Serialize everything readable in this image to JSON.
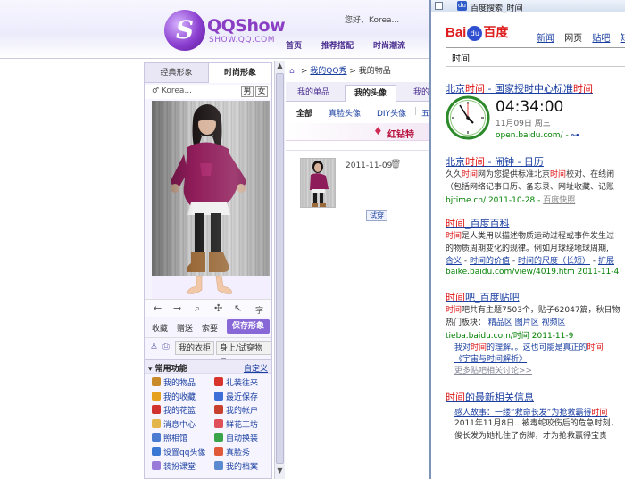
{
  "qqshow": {
    "logo_text": "QQShow",
    "logo_sub": "SHOW.QQ.COM",
    "greeting": "您好，",
    "user_short": "Korea...",
    "user_name": "Korea...",
    "nav": [
      "首页",
      "推荐搭配",
      "时尚潮流"
    ],
    "left_tabs": [
      "经典形象",
      "时尚形象"
    ],
    "gender_buttons": [
      "男",
      "女"
    ],
    "zoom_icon_label": "字",
    "actions": [
      "收藏",
      "赠送",
      "索要"
    ],
    "save_button": "保存形象",
    "wardrobe_buttons": [
      "我的衣柜",
      "身上/试穿物品"
    ],
    "functions_title": "常用功能",
    "customize": "自定义",
    "functions": [
      {
        "label": "我的物品",
        "color": "#c98a2a"
      },
      {
        "label": "礼装往来",
        "color": "#d9342b"
      },
      {
        "label": "我的收藏",
        "color": "#e5a020"
      },
      {
        "label": "最近保存",
        "color": "#3e6fd8"
      },
      {
        "label": "我的花篮",
        "color": "#d2322f"
      },
      {
        "label": "我的帐户",
        "color": "#c8402e"
      },
      {
        "label": "消息中心",
        "color": "#e4b54a"
      },
      {
        "label": "鲜花工坊",
        "color": "#e0505a"
      },
      {
        "label": "照相馆",
        "color": "#4a7bd0"
      },
      {
        "label": "自动换装",
        "color": "#3aa44a"
      },
      {
        "label": "设置qq头像",
        "color": "#3a78d4"
      },
      {
        "label": "真脸秀",
        "color": "#e05a3a"
      },
      {
        "label": "装扮课堂",
        "color": "#9a7ad8"
      },
      {
        "label": "我的档案",
        "color": "#5a8ad0"
      }
    ],
    "breadcrumb": [
      "我的QQ秀",
      "我的物品"
    ],
    "breadcrumb_sep": ">",
    "right_tabs": [
      "我的单品",
      "我的头像",
      "我的"
    ],
    "sub_tabs": [
      "全部",
      "真脸头像",
      "DIY头像",
      "五"
    ],
    "promo_text": "红钻特",
    "item_date": "2011-11-09",
    "try_button": "试穿"
  },
  "baidu": {
    "window_title": "百度搜索_时间",
    "logo_bai": "Bai",
    "logo_paw": "du",
    "logo_du": "百度",
    "nav": [
      "新闻",
      "网页",
      "贴吧",
      "知道"
    ],
    "query": "时间",
    "results": [
      {
        "title_a": "北京",
        "title_em": "时间",
        "title_b": " - 国家授时中心标准",
        "title_em2": "时间",
        "time": "04:34:00",
        "date": "11月09日  周三",
        "url": "open.baidu.com/ - ",
        "url_extra": "⊶"
      },
      {
        "title_a": "北京",
        "title_em": "时间",
        "title_b": " - 闹钟 - 日历",
        "body1_a": "久久",
        "body1_em": "时间",
        "body1_b": "网为您提供标准北京",
        "body1_em2": "时间",
        "body1_c": "校对、在线闹",
        "body2": "（包括网络记事日历、备忘录、网址收藏、记账",
        "url": "bjtime.cn/ 2011-10-28 - ",
        "snapshot": "百度快照"
      },
      {
        "title_em": "时间",
        "title_b": "_百度百科",
        "body1_em": "时间",
        "body1_b": "是人类用以描述物质运动过程或事件发生过",
        "body2": "的物质周期变化的规律。例如月球绕地球周期,",
        "links": [
          "含义",
          "时间的价值",
          "时间的尺度（长短）",
          "扩展"
        ],
        "url": "baike.baidu.com/view/4019.htm 2011-11-4"
      },
      {
        "title_em": "时间",
        "title_b": "吧_百度贴吧",
        "body1_em": "时间",
        "body1_b": "吧共有主题7503个，贴子62047篇，秋日物",
        "body2_a": "热门板块：",
        "body2_links": [
          "精品区",
          "图片区",
          "视频区"
        ],
        "url": "tieba.baidu.com/时间 2011-11-9",
        "sub1_a": "我对",
        "sub1_em": "时间",
        "sub1_b": "的理解。。这也可能是真正的",
        "sub1_em2": "时间",
        "sub2": "《宇宙与时间解析》",
        "sub3": "更多贴吧相关讨论>>"
      },
      {
        "title_em": "时间",
        "title_b": "的最新相关信息",
        "sub1": "感人故事：一缕“救命长发”为抢救霸得",
        "sub1_em": "时间",
        "body1": "2011年11月8日...被毒蛇咬伤后的危急时刻，",
        "body2": "俊长发为她扎住了伤脚，才为抢救赢得宝贵"
      }
    ]
  }
}
